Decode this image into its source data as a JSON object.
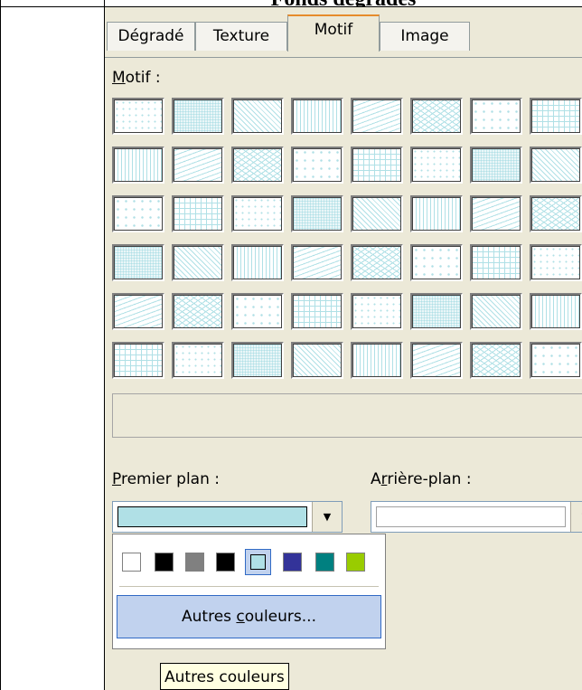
{
  "document": {
    "heading": "Fonds dégradés"
  },
  "tabs": [
    {
      "label": "Dégradé",
      "active": false
    },
    {
      "label": "Texture",
      "active": false
    },
    {
      "label": "Motif",
      "active": true
    },
    {
      "label": "Image",
      "active": false
    }
  ],
  "pattern_section": {
    "label_hotkey": "M",
    "label_rest": "otif :"
  },
  "pattern_grid": {
    "rows": 6,
    "visible_columns": 8,
    "foreground": "#b0e0e6",
    "background": "#ffffff"
  },
  "foreground": {
    "label_hotkey": "P",
    "label_rest": "remier plan :",
    "selected_color": "#b0e0e6"
  },
  "background": {
    "label_pre": "A",
    "label_hotkey": "r",
    "label_rest": "rière-plan :",
    "selected_color": "#ffffff"
  },
  "color_popup": {
    "swatches": [
      "#ffffff",
      "#000000",
      "#808080",
      "#000000",
      "#b0e0e6",
      "#333399",
      "#008080",
      "#99cc00"
    ],
    "selected_index": 4,
    "more_pre": "Autres ",
    "more_hotkey": "c",
    "more_rest": "ouleurs..."
  },
  "tooltip": "Autres couleurs",
  "colors": {
    "dialog_bg": "#ece9d8",
    "accent": "#316ac5",
    "tab_highlight": "#e68b2c"
  }
}
